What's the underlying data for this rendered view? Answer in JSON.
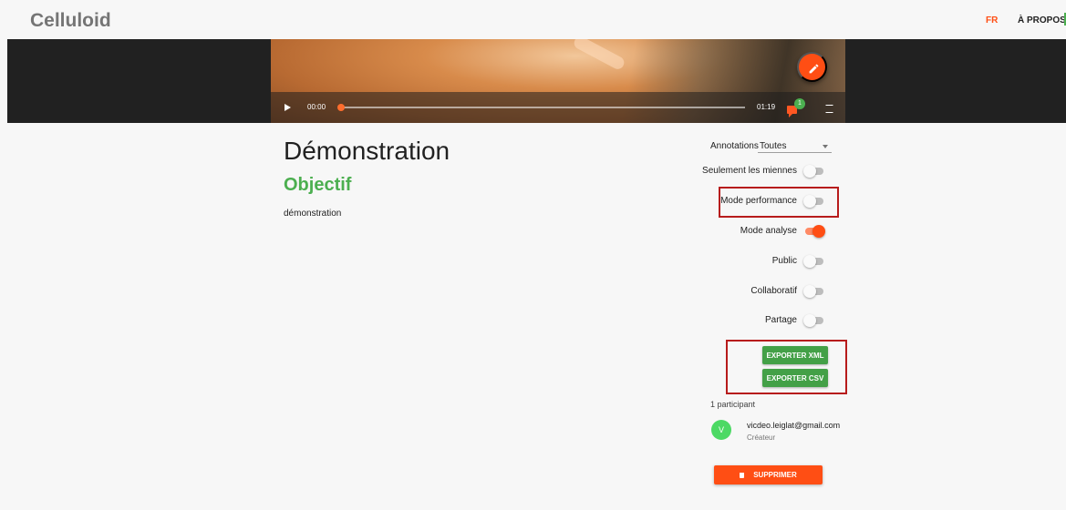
{
  "app": {
    "brand": "Celluloid"
  },
  "nav": {
    "lang": "FR",
    "about": "À PROPOS"
  },
  "player": {
    "current_time": "00:00",
    "duration": "01:19",
    "progress": 0.0,
    "annotation_count": "1"
  },
  "project": {
    "title": "Démonstration",
    "objective": "Objectif",
    "description": "démonstration"
  },
  "panel": {
    "annotations_label": "Annotations",
    "annotations_value": "Toutes",
    "toggles": [
      {
        "label": "Seulement les miennes",
        "on": false
      },
      {
        "label": "Mode performance",
        "on": false
      },
      {
        "label": "Mode analyse",
        "on": true
      },
      {
        "label": "Public",
        "on": false
      },
      {
        "label": "Collaboratif",
        "on": false
      },
      {
        "label": "Partage",
        "on": false
      }
    ],
    "export_xml": "EXPORTER XML",
    "export_csv": "EXPORTER CSV",
    "participants_count": "1 participant",
    "participant": {
      "initial": "V",
      "email": "vicdeo.leiglat@gmail.com",
      "role": "Créateur"
    },
    "delete_label": "SUPPRIMER"
  },
  "colors": {
    "accent": "#ff4e14",
    "green": "#4caf50",
    "highlight": "#b71c1c"
  },
  "icons": {
    "play": "play-icon",
    "edit": "pencil-icon",
    "chat": "chat-icon",
    "fullscreen": "fullscreen-icon",
    "delete": "trash-icon"
  }
}
